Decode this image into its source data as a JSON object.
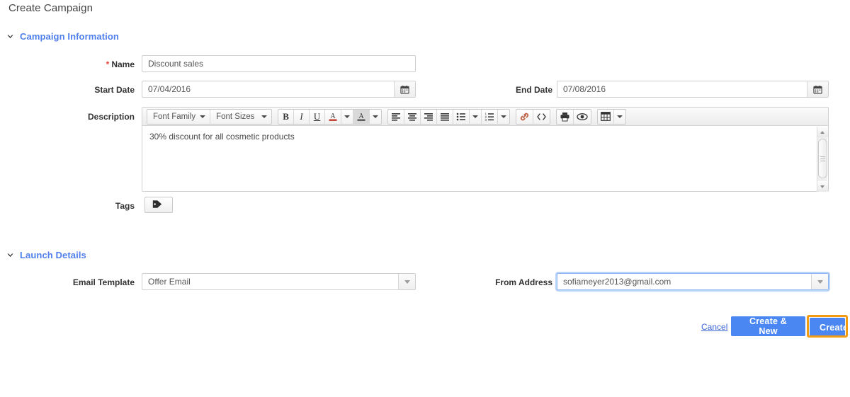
{
  "page": {
    "title": "Create Campaign"
  },
  "sections": {
    "campaign_information": {
      "label": "Campaign Information",
      "caret_icon": "chevron-down-icon",
      "expanded": true
    },
    "launch_details": {
      "label": "Launch Details",
      "caret_icon": "chevron-down-icon",
      "expanded": true
    }
  },
  "fields": {
    "name": {
      "label": "Name",
      "required_marker": "*",
      "value": "Discount sales",
      "placeholder": "Discount sales"
    },
    "start_date": {
      "label": "Start Date",
      "value": "07/04/2016",
      "icon": "calendar-icon"
    },
    "end_date": {
      "label": "End Date",
      "value": "07/08/2016",
      "icon": "calendar-icon"
    },
    "description": {
      "label": "Description",
      "body_text": "30% discount  for all cosmetic products"
    },
    "tags": {
      "label": "Tags",
      "icon": "tag-icon",
      "caret_icon": "caret-down-icon"
    },
    "email_template": {
      "label": "Email Template",
      "value": "Offer Email",
      "caret_icon": "caret-down-icon"
    },
    "from_address": {
      "label": "From Address",
      "value": "sofiameyer2013@gmail.com",
      "caret_icon": "caret-down-icon",
      "focused": true
    }
  },
  "editor_toolbar": {
    "font_family": {
      "label": "Font Family",
      "icon": "caret-down-icon"
    },
    "font_sizes": {
      "label": "Font Sizes",
      "icon": "caret-down-icon"
    },
    "bold": {
      "label": "B",
      "icon": "bold-icon"
    },
    "italic": {
      "label": "I",
      "icon": "italic-icon"
    },
    "underline": {
      "label": "U",
      "icon": "underline-icon"
    },
    "text_color": {
      "label": "A",
      "icon": "text-color-icon"
    },
    "background_color": {
      "label": "A",
      "icon": "background-color-icon"
    },
    "align_left": {
      "icon": "align-left-icon"
    },
    "align_center": {
      "icon": "align-center-icon"
    },
    "align_right": {
      "icon": "align-right-icon"
    },
    "align_justify": {
      "icon": "align-justify-icon"
    },
    "bullet_list": {
      "icon": "bullet-list-icon"
    },
    "numbered_list": {
      "icon": "numbered-list-icon"
    },
    "insert_link": {
      "icon": "link-icon"
    },
    "source_code": {
      "icon": "source-code-icon"
    },
    "print": {
      "icon": "print-icon"
    },
    "preview": {
      "icon": "eye-icon"
    },
    "table": {
      "icon": "table-icon"
    }
  },
  "scrollbar": {
    "up_icon": "scroll-up-arrow-icon",
    "down_icon": "scroll-down-arrow-icon",
    "thumb": "scroll-thumb"
  },
  "actions": {
    "cancel": "Cancel",
    "create_and_new": "Create & New",
    "create": "Create"
  },
  "colors": {
    "accent_blue": "#4a87f2",
    "section_header_blue": "#4f7fee",
    "required_red": "#e8453c",
    "focus_ring_orange": "#f39c12",
    "field_border": "#cfcfcf"
  }
}
